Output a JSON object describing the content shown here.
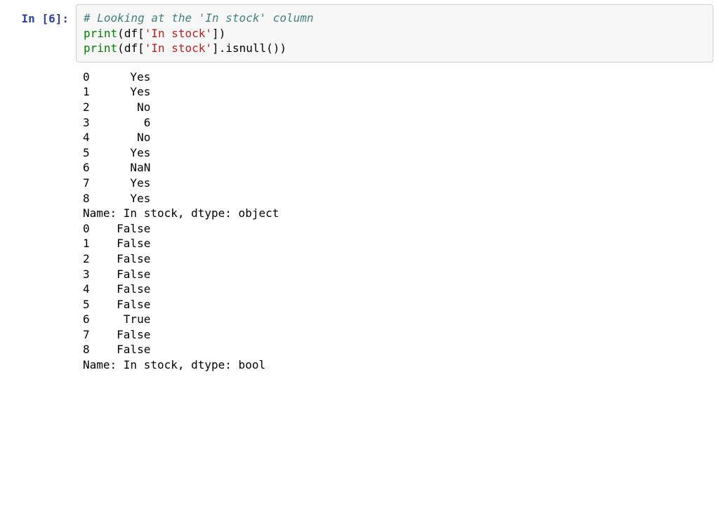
{
  "prompt": {
    "in_label": "In ",
    "lbrac": "[",
    "exec_count": "6",
    "rbrac": "]:"
  },
  "code": {
    "l1_comment": "# Looking at the 'In stock' column",
    "l2": {
      "print": "print",
      "p_open": "(",
      "df": "df",
      "b_open": "[",
      "str": "'In stock'",
      "b_close": "]",
      "p_close": ")"
    },
    "l3": {
      "print": "print",
      "p_open": "(",
      "df": "df",
      "b_open": "[",
      "str": "'In stock'",
      "b_close": "]",
      "dot": ".",
      "isnull": "isnull",
      "call": "()",
      "p_close": ")"
    }
  },
  "output": {
    "series1": {
      "rows": [
        "0      Yes",
        "1      Yes",
        "2       No",
        "3        6",
        "4       No",
        "5      Yes",
        "6      NaN",
        "7      Yes",
        "8      Yes"
      ],
      "footer": "Name: In stock, dtype: object"
    },
    "series2": {
      "rows": [
        "0    False",
        "1    False",
        "2    False",
        "3    False",
        "4    False",
        "5    False",
        "6     True",
        "7    False",
        "8    False"
      ],
      "footer": "Name: In stock, dtype: bool"
    }
  }
}
